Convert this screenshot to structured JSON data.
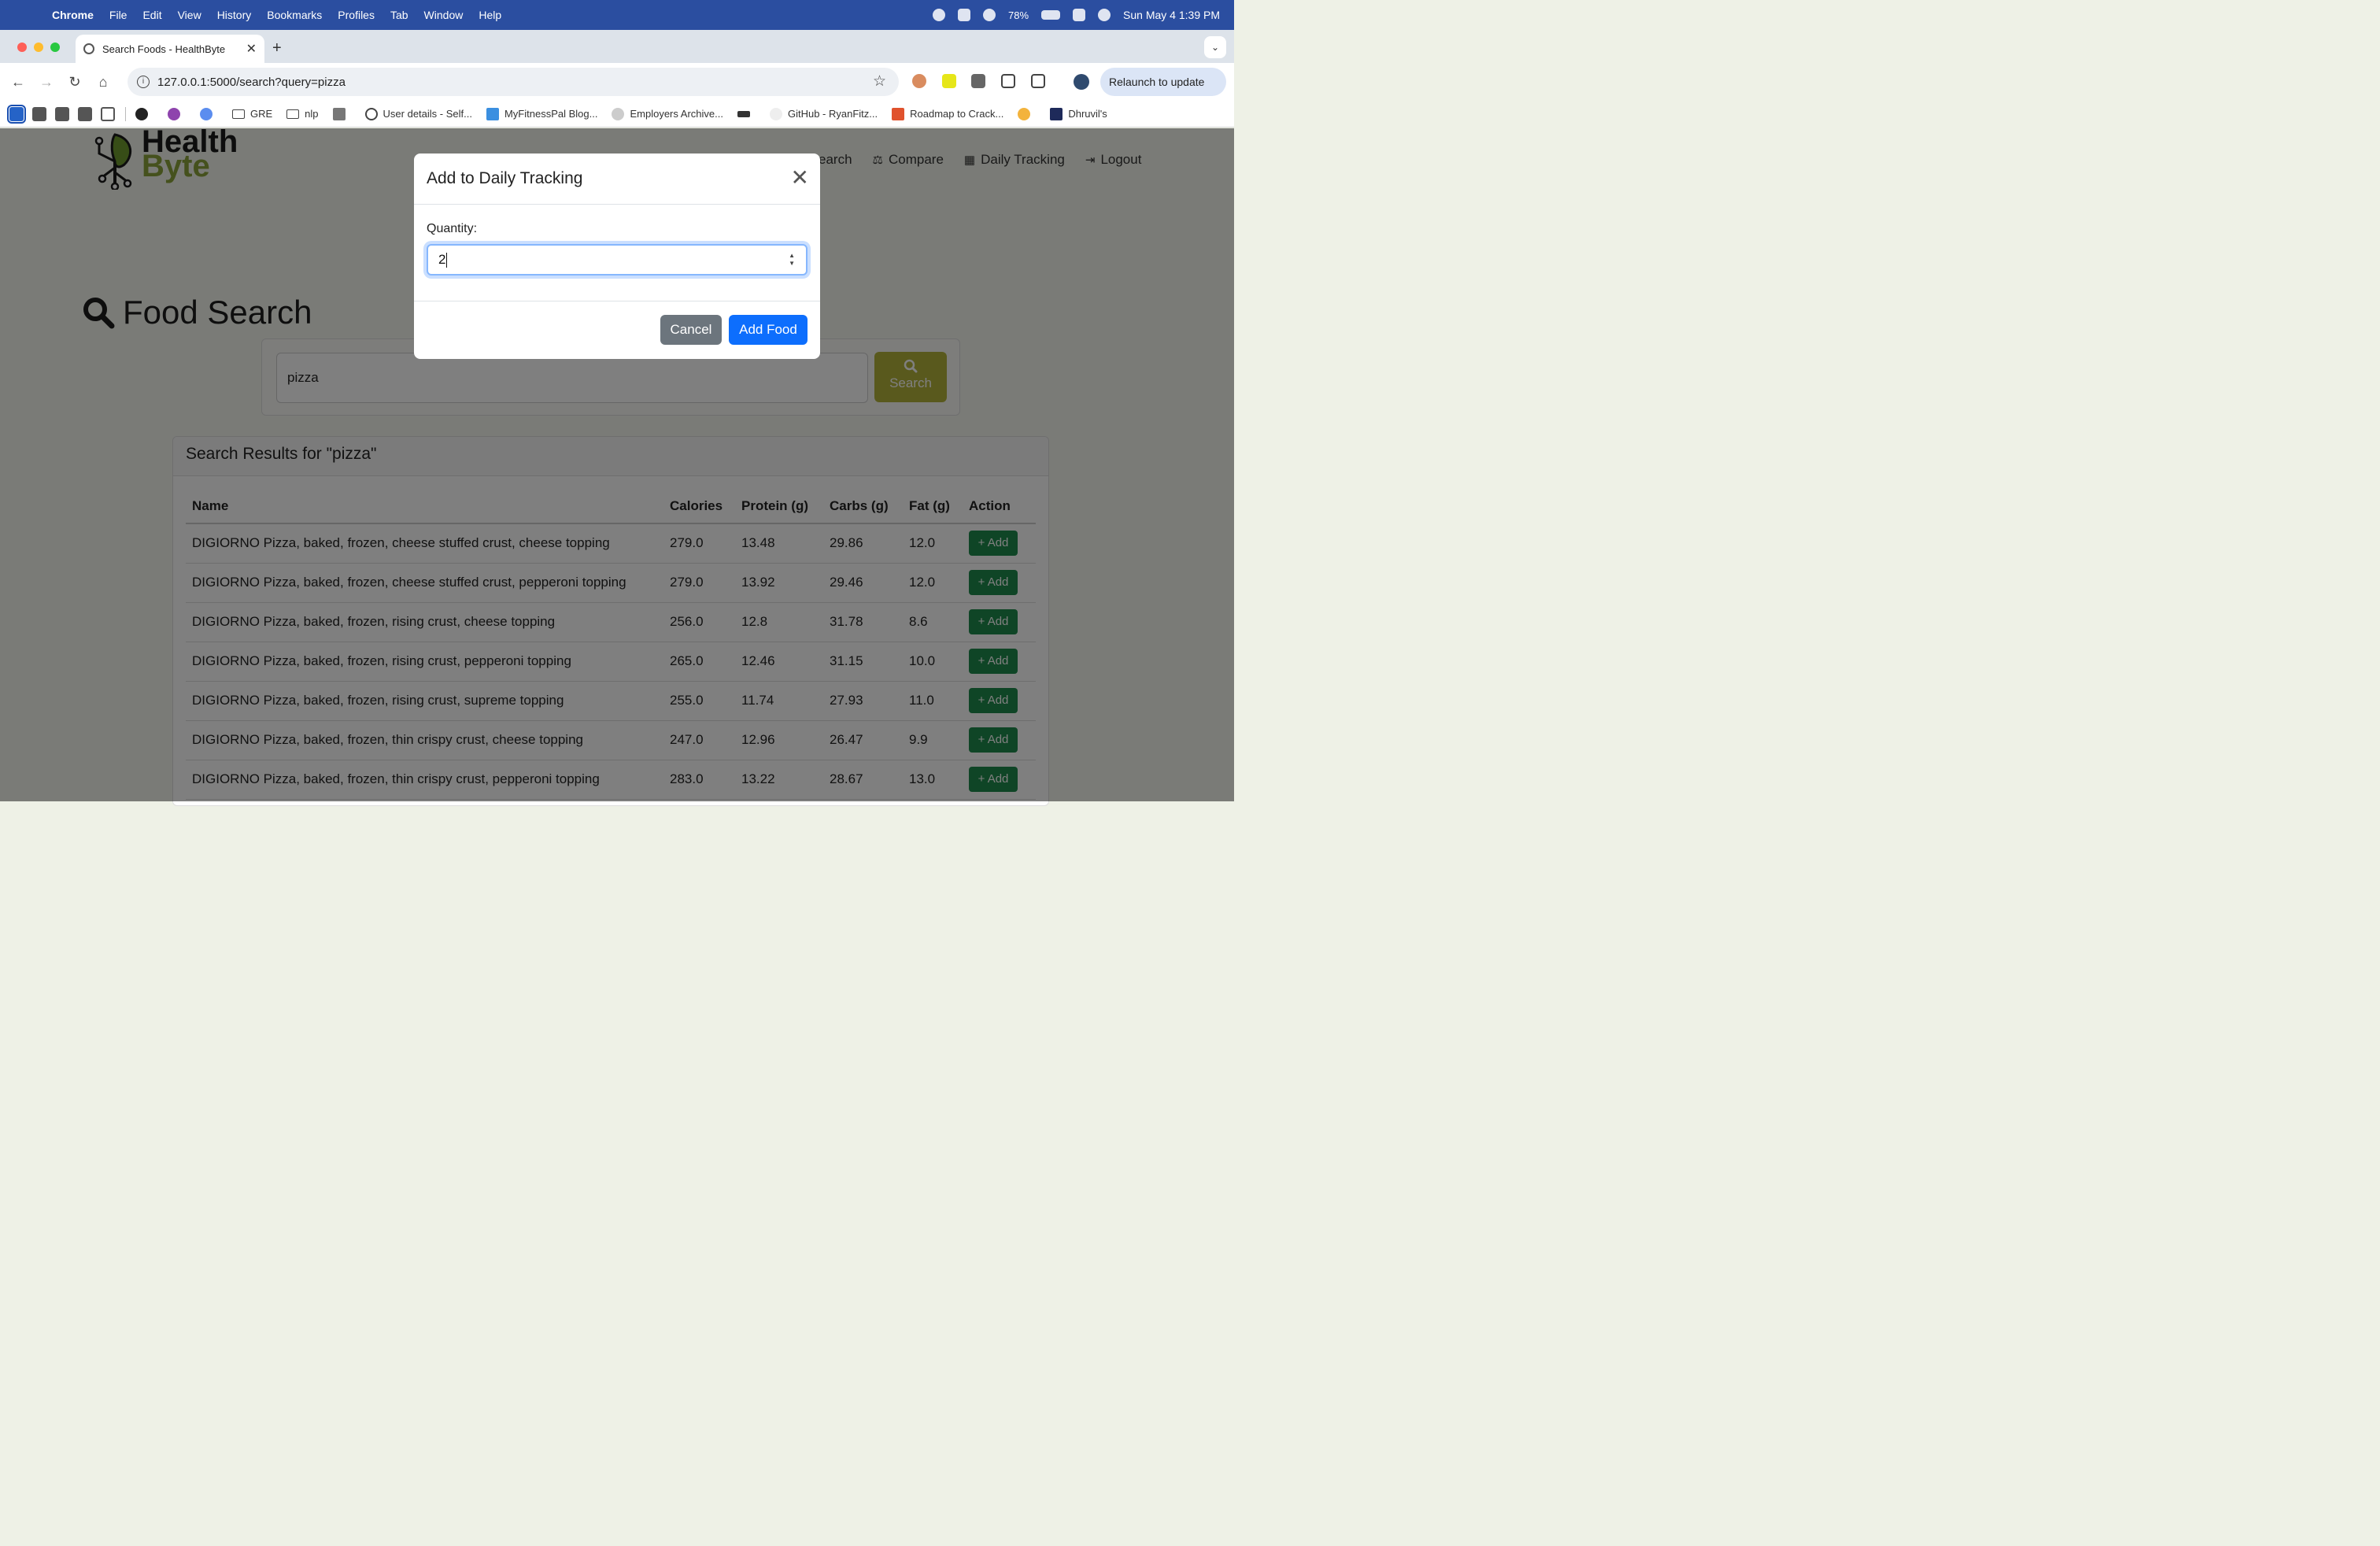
{
  "menubar": {
    "app": "Chrome",
    "items": [
      "File",
      "Edit",
      "View",
      "History",
      "Bookmarks",
      "Profiles",
      "Tab",
      "Window",
      "Help"
    ],
    "battery": "78%",
    "datetime": "Sun May 4  1:39 PM"
  },
  "browser": {
    "tab_title": "Search Foods - HealthByte",
    "url": "127.0.0.1:5000/search?query=pizza",
    "relaunch_label": "Relaunch to update",
    "bookmarks": [
      "GRE",
      "nlp",
      "User details - Self...",
      "MyFitnessPal Blog...",
      "Employers Archive...",
      "GitHub - RyanFitz...",
      "Roadmap to Crack...",
      "Dhruvil's"
    ]
  },
  "site": {
    "logo_line1": "Health",
    "logo_line2": "Byte",
    "nav": {
      "search": "earch",
      "compare": "Compare",
      "daily_tracking": "Daily Tracking",
      "logout": "Logout"
    }
  },
  "search": {
    "heading": "Food Search",
    "query": "pizza",
    "button_label": "Search"
  },
  "results": {
    "heading": "Search Results for \"pizza\"",
    "columns": [
      "Name",
      "Calories",
      "Protein (g)",
      "Carbs (g)",
      "Fat (g)",
      "Action"
    ],
    "add_label": "+ Add",
    "rows": [
      {
        "name": "DIGIORNO Pizza, baked, frozen, cheese stuffed crust, cheese topping",
        "calories": "279.0",
        "protein": "13.48",
        "carbs": "29.86",
        "fat": "12.0"
      },
      {
        "name": "DIGIORNO Pizza, baked, frozen, cheese stuffed crust, pepperoni topping",
        "calories": "279.0",
        "protein": "13.92",
        "carbs": "29.46",
        "fat": "12.0"
      },
      {
        "name": "DIGIORNO Pizza, baked, frozen, rising crust, cheese topping",
        "calories": "256.0",
        "protein": "12.8",
        "carbs": "31.78",
        "fat": "8.6"
      },
      {
        "name": "DIGIORNO Pizza, baked, frozen, rising crust, pepperoni topping",
        "calories": "265.0",
        "protein": "12.46",
        "carbs": "31.15",
        "fat": "10.0"
      },
      {
        "name": "DIGIORNO Pizza, baked, frozen, rising crust, supreme topping",
        "calories": "255.0",
        "protein": "11.74",
        "carbs": "27.93",
        "fat": "11.0"
      },
      {
        "name": "DIGIORNO Pizza, baked, frozen, thin crispy crust, cheese topping",
        "calories": "247.0",
        "protein": "12.96",
        "carbs": "26.47",
        "fat": "9.9"
      },
      {
        "name": "DIGIORNO Pizza, baked, frozen, thin crispy crust, pepperoni topping",
        "calories": "283.0",
        "protein": "13.22",
        "carbs": "28.67",
        "fat": "13.0"
      }
    ]
  },
  "modal": {
    "title": "Add to Daily Tracking",
    "quantity_label": "Quantity:",
    "quantity_value": "2",
    "cancel_label": "Cancel",
    "add_label": "Add Food"
  }
}
